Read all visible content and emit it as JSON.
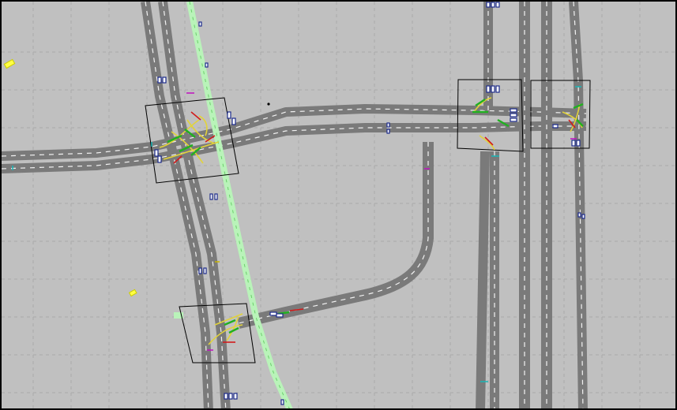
{
  "view": {
    "background": "#c0c0c0",
    "grid_color": "#aaaaaa",
    "road_color": "#7a7a7a",
    "bike_lane_color": "#b9f3b9"
  },
  "legend": {
    "junction_box": "junction-box-icon",
    "vehicle": "vehicle-icon",
    "pedestrian": "pedestrian-icon",
    "traffic_light_green": "#21b021",
    "traffic_light_red": "#d11b1b",
    "connection_yellow": "#e2d33a"
  }
}
